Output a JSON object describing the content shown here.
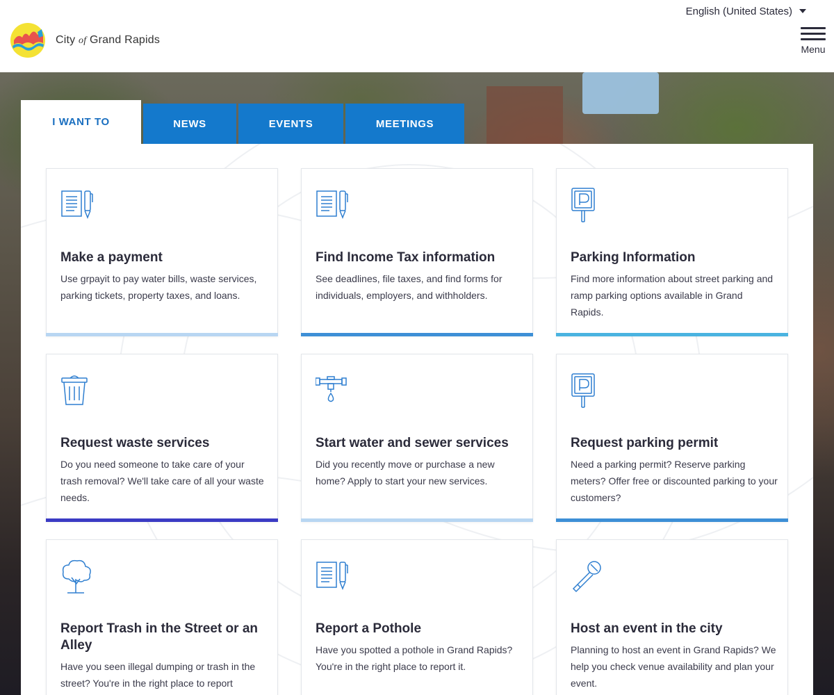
{
  "header": {
    "language": "English (United States)",
    "logo_text_before": "City",
    "logo_text_of": "of",
    "logo_text_after": "Grand Rapids",
    "menu_label": "Menu"
  },
  "tabs": [
    {
      "label": "I WANT TO",
      "active": true
    },
    {
      "label": "NEWS",
      "active": false
    },
    {
      "label": "EVENTS",
      "active": false
    },
    {
      "label": "MEETINGS",
      "active": false
    }
  ],
  "cards": [
    {
      "title": "Make a payment",
      "desc": "Use grpayit to pay water bills, waste services, parking tickets, property taxes, and loans.",
      "icon": "document-pen-icon",
      "accent": "#b8d6f2"
    },
    {
      "title": "Find Income Tax information",
      "desc": "See deadlines, file taxes, and find forms for individuals, employers, and withholders.",
      "icon": "document-pen-icon",
      "accent": "#3d8fd6"
    },
    {
      "title": "Parking Information",
      "desc": "Find more information about street parking and ramp parking options available in Grand Rapids.",
      "icon": "parking-sign-icon",
      "accent": "#4ab3e0"
    },
    {
      "title": "Request waste services",
      "desc": "Do you need someone to take care of your trash removal? We'll take care of all your waste needs.",
      "icon": "trash-can-icon",
      "accent": "#3b3bc4"
    },
    {
      "title": "Start water and sewer services",
      "desc": "Did you recently move or purchase a new home? Apply to start your new services.",
      "icon": "water-pipe-icon",
      "accent": "#b8d6f2"
    },
    {
      "title": "Request parking permit",
      "desc": "Need a parking permit? Reserve parking meters? Offer free or discounted parking to your customers?",
      "icon": "parking-sign-icon",
      "accent": "#3d8fd6"
    },
    {
      "title": "Report Trash in the Street or an Alley",
      "desc": "Have you seen illegal dumping or trash in the street? You're in the right place to report",
      "icon": "tree-icon",
      "accent": "#b8d6f2"
    },
    {
      "title": "Report a Pothole",
      "desc": "Have you spotted a pothole in Grand Rapids? You're in the right place to report it.",
      "icon": "document-pen-icon",
      "accent": "#3d8fd6"
    },
    {
      "title": "Host an event in the city",
      "desc": "Planning to host an event in Grand Rapids? We help you check venue availability and plan your event.",
      "icon": "microphone-icon",
      "accent": "#4ab3e0"
    }
  ],
  "colors": {
    "tab_blue": "#1479cc",
    "active_tab_text": "#1a6fc0",
    "icon_blue": "#2f7fd0"
  }
}
